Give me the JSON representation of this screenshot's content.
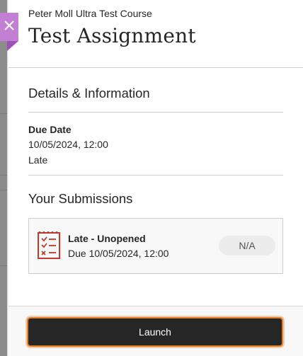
{
  "header": {
    "course_name": "Peter Moll Ultra Test Course",
    "title": "Test Assignment",
    "close_icon": "close-icon"
  },
  "details": {
    "heading": "Details & Information",
    "due_label": "Due Date",
    "due_value": "10/05/2024, 12:00",
    "status": "Late"
  },
  "submissions": {
    "heading": "Your Submissions",
    "items": [
      {
        "icon": "assignment-list-icon",
        "status": "Late - Unopened",
        "due": "Due 10/05/2024, 12:00",
        "grade": "N/A"
      }
    ]
  },
  "footer": {
    "launch_label": "Launch"
  },
  "colors": {
    "accent_purple": "#c27fd4",
    "icon_red": "#c0392b",
    "focus_orange": "#e57e25",
    "button_dark": "#262626"
  }
}
